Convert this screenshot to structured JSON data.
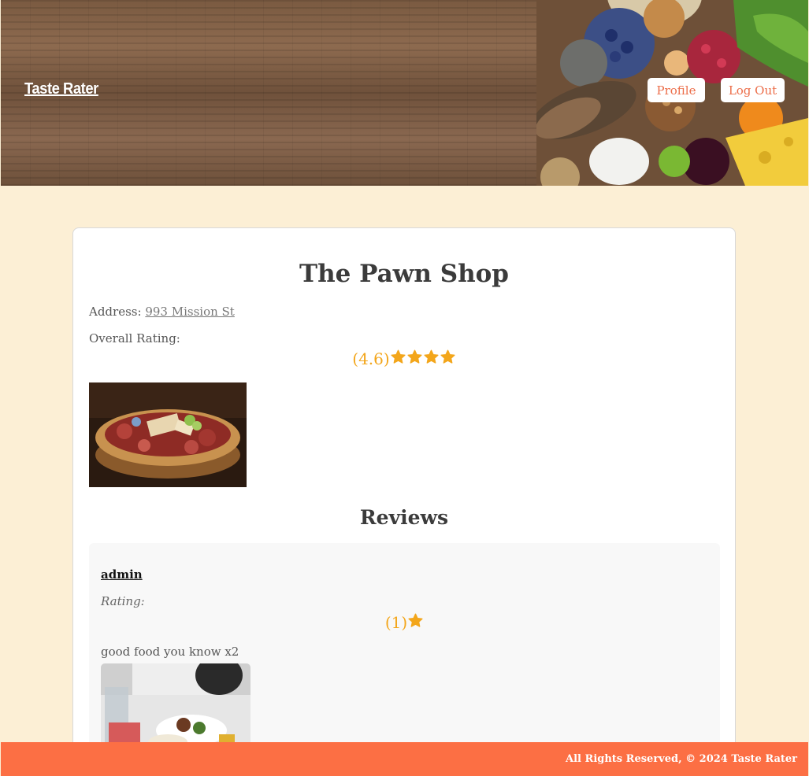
{
  "header": {
    "brand": "Taste Rater",
    "nav": {
      "profile_label": "Profile",
      "logout_label": "Log Out"
    }
  },
  "restaurant": {
    "name": "The Pawn Shop",
    "address_label": "Address:",
    "address": "993 Mission St",
    "overall_rating_label": "Overall Rating:",
    "overall_rating_text": "(4.6)",
    "overall_rating_value": 4.6,
    "overall_stars_shown": 4
  },
  "reviews": {
    "heading": "Reviews",
    "items": [
      {
        "username": "admin",
        "rating_label": "Rating:",
        "rating_text": "(1)",
        "rating_value": 1,
        "stars_shown": 1,
        "text": "good food you know x2"
      }
    ]
  },
  "footer": {
    "text": "All Rights Reserved, © 2024 Taste Rater"
  },
  "colors": {
    "accent": "#fc6f44",
    "star": "#f3a61b",
    "background": "#fcefd5",
    "nav_text": "#ec6d49"
  }
}
